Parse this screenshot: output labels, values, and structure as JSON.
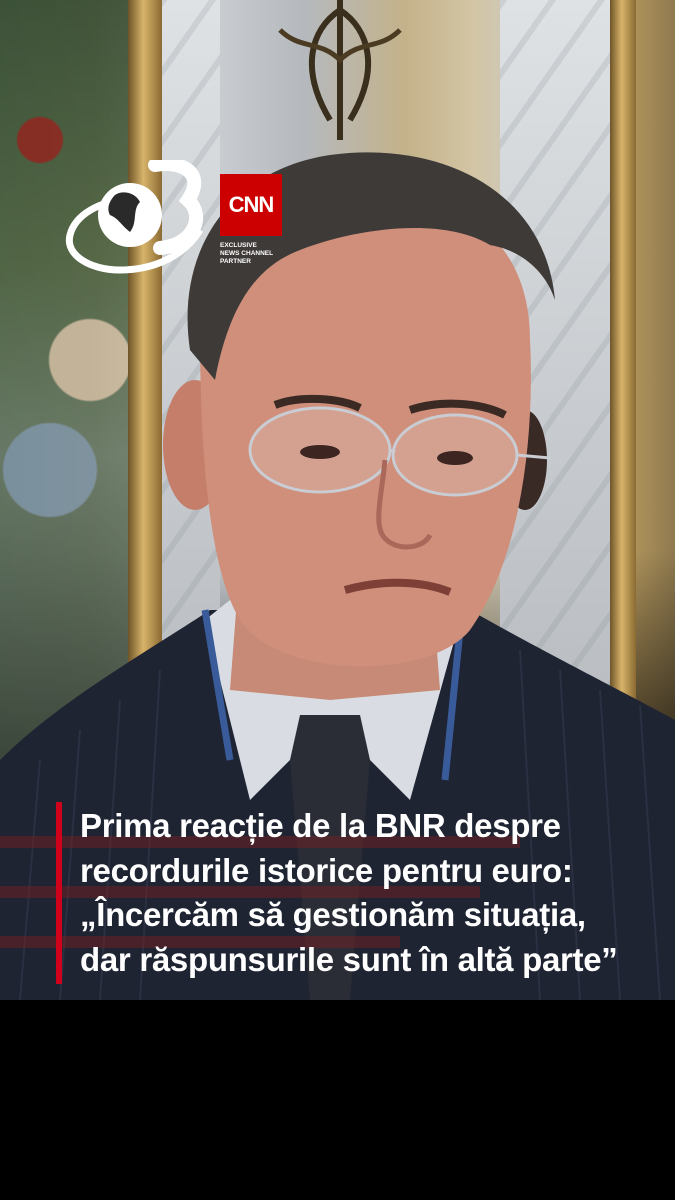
{
  "logos": {
    "antena_icon": "antena3-globe-logo",
    "antena_number": "3",
    "cnn_label": "CNN",
    "cnn_partner_lines": [
      "EXCLUSIVE",
      "NEWS CHANNEL",
      "PARTNER"
    ]
  },
  "headline": {
    "lines": [
      "Prima reacție de la BNR despre",
      "recordurile istorice pentru euro:",
      "„Încercăm să gestionăm situația,",
      "dar răspunsurile sunt în altă parte”"
    ]
  },
  "colors": {
    "accent_bar": "#d0021b",
    "cnn_red": "#cc0000",
    "background": "#000000",
    "headline_text": "#ffffff"
  }
}
